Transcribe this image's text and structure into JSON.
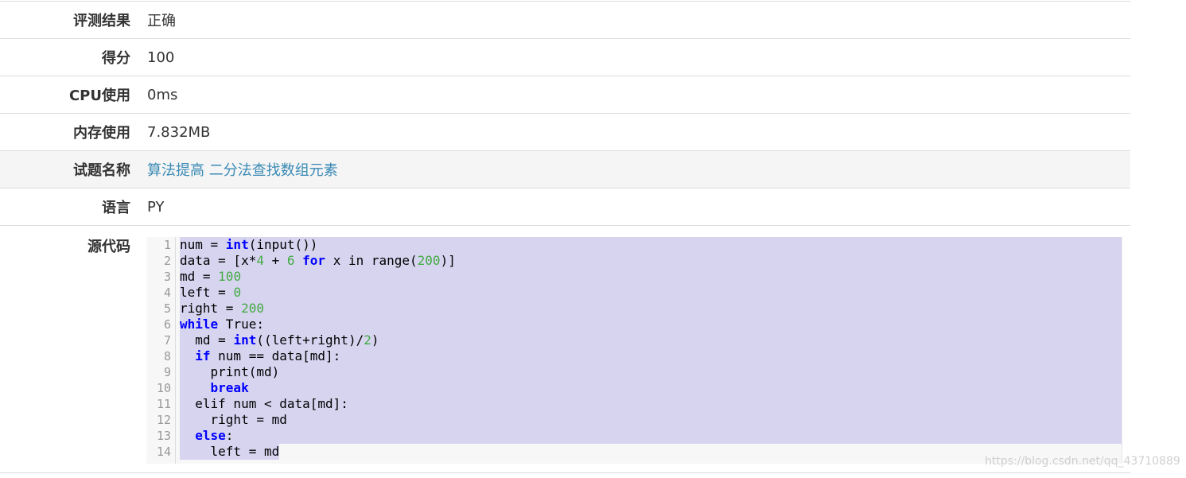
{
  "rows": [
    {
      "label": "评测结果",
      "value": "正确"
    },
    {
      "label": "得分",
      "value": "100"
    },
    {
      "label": "CPU使用",
      "value": "0ms"
    },
    {
      "label": "内存使用",
      "value": "7.832MB"
    },
    {
      "label": "试题名称",
      "value": "算法提高 二分法查找数组元素"
    },
    {
      "label": "语言",
      "value": "PY"
    },
    {
      "label": "源代码"
    }
  ],
  "code": {
    "line_numbers": [
      "1",
      "2",
      "3",
      "4",
      "5",
      "6",
      "7",
      "8",
      "9",
      "10",
      "11",
      "12",
      "13",
      "14"
    ]
  },
  "colors": {
    "link": "#3a8ab5",
    "keyword": "#0000ff",
    "number": "#44aa44",
    "selection": "#d7d4f0"
  },
  "watermark": "https://blog.csdn.net/qq_43710889"
}
